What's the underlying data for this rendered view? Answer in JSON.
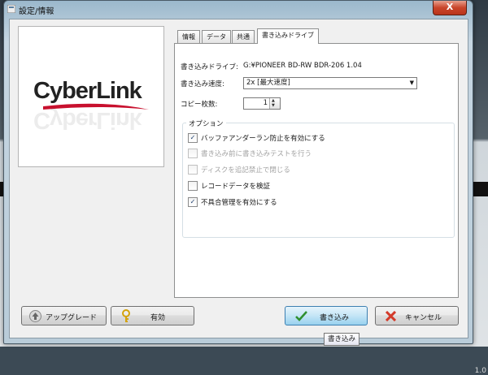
{
  "window": {
    "title": "設定/情報",
    "close_label": "X"
  },
  "logo": {
    "text": "CyberLink"
  },
  "tabs": [
    "情報",
    "データ",
    "共通",
    "書き込みドライブ"
  ],
  "drive": {
    "drive_label": "書き込みドライブ:",
    "drive_value": "G:¥PIONEER BD-RW BDR-206 1.04",
    "speed_label": "書き込み速度:",
    "speed_value": "2x [最大速度]",
    "copies_label": "コピー枚数:",
    "copies_value": "1"
  },
  "options": {
    "title": "オプション",
    "items": [
      {
        "label": "バッファアンダーラン防止を有効にする",
        "checked": true,
        "enabled": true
      },
      {
        "label": "書き込み前に書き込みテストを行う",
        "checked": false,
        "enabled": false
      },
      {
        "label": "ディスクを追記禁止で閉じる",
        "checked": false,
        "enabled": false
      },
      {
        "label": "レコードデータを検証",
        "checked": false,
        "enabled": true
      },
      {
        "label": "不具合管理を有効にする",
        "checked": true,
        "enabled": true
      }
    ]
  },
  "buttons": {
    "upgrade": "アップグレード",
    "activate": "有効",
    "burn": "書き込み",
    "cancel": "キャンセル"
  },
  "tooltip": "書き込み",
  "background": {
    "value": "1.0"
  },
  "colors": {
    "accent": "#3c7fb1",
    "close": "#c9452a",
    "logo_red": "#c8102e"
  }
}
